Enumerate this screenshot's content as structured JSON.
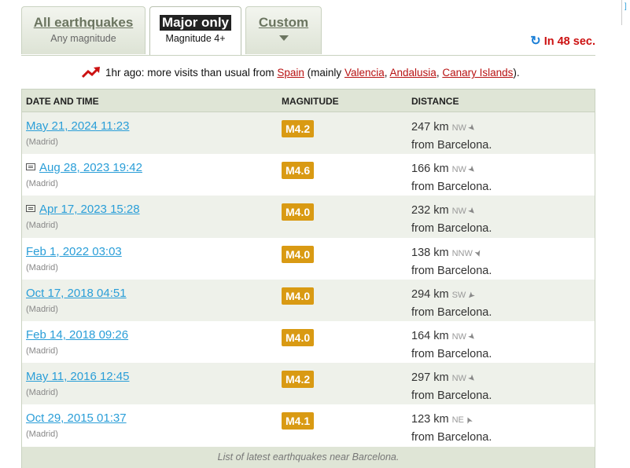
{
  "tabs": [
    {
      "title": "All earthquakes",
      "subtitle": "Any magnitude",
      "active": false
    },
    {
      "title": "Major only",
      "subtitle": "Magnitude 4+",
      "active": true
    },
    {
      "title": "Custom",
      "subtitle": "",
      "active": false
    }
  ],
  "refresh": {
    "label": "In 48 sec."
  },
  "trend": {
    "text_before": "1hr ago: more visits than usual from",
    "country": "Spain",
    "mainly": "(mainly",
    "regions": [
      "Valencia",
      "Andalusia",
      "Canary Islands"
    ],
    "close": ")."
  },
  "table": {
    "headers": {
      "date": "DATE AND TIME",
      "magnitude": "MAGNITUDE",
      "distance": "DISTANCE"
    },
    "rows": [
      {
        "date": "May 21, 2024 11:23",
        "tz": "(Madrid)",
        "mag": "M4.2",
        "dist": "247 km",
        "dir": "NW",
        "from": "from Barcelona.",
        "doc": false
      },
      {
        "date": "Aug 28, 2023 19:42",
        "tz": "(Madrid)",
        "mag": "M4.6",
        "dist": "166 km",
        "dir": "NW",
        "from": "from Barcelona.",
        "doc": true
      },
      {
        "date": "Apr 17, 2023 15:28",
        "tz": "(Madrid)",
        "mag": "M4.0",
        "dist": "232 km",
        "dir": "NW",
        "from": "from Barcelona.",
        "doc": true
      },
      {
        "date": "Feb 1, 2022 03:03",
        "tz": "(Madrid)",
        "mag": "M4.0",
        "dist": "138 km",
        "dir": "NNW",
        "from": "from Barcelona.",
        "doc": false
      },
      {
        "date": "Oct 17, 2018 04:51",
        "tz": "(Madrid)",
        "mag": "M4.0",
        "dist": "294 km",
        "dir": "SW",
        "from": "from Barcelona.",
        "doc": false
      },
      {
        "date": "Feb 14, 2018 09:26",
        "tz": "(Madrid)",
        "mag": "M4.0",
        "dist": "164 km",
        "dir": "NW",
        "from": "from Barcelona.",
        "doc": false
      },
      {
        "date": "May 11, 2016 12:45",
        "tz": "(Madrid)",
        "mag": "M4.2",
        "dist": "297 km",
        "dir": "NW",
        "from": "from Barcelona.",
        "doc": false
      },
      {
        "date": "Oct 29, 2015 01:37",
        "tz": "(Madrid)",
        "mag": "M4.1",
        "dist": "123 km",
        "dir": "NE",
        "from": "from Barcelona.",
        "doc": false
      }
    ],
    "footer": "List of latest earthquakes near Barcelona."
  },
  "colors": {
    "accent": "#2a9ed8",
    "magnitude_badge": "#d99a13",
    "alert": "#cc1111",
    "header_bg": "#dfe5d6"
  }
}
